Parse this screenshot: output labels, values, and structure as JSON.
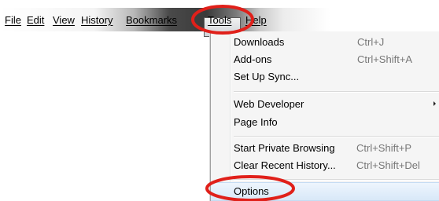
{
  "menubar": {
    "items": [
      "File",
      "Edit",
      "View",
      "History",
      "Bookmarks",
      "Tools",
      "Help"
    ]
  },
  "tools_menu": {
    "items": [
      {
        "label": "Downloads",
        "shortcut": "Ctrl+J"
      },
      {
        "label": "Add-ons",
        "shortcut": "Ctrl+Shift+A"
      },
      {
        "label": "Set Up Sync...",
        "shortcut": ""
      },
      {
        "label": "Web Developer",
        "shortcut": "",
        "submenu": true
      },
      {
        "label": "Page Info",
        "shortcut": ""
      },
      {
        "label": "Start Private Browsing",
        "shortcut": "Ctrl+Shift+P"
      },
      {
        "label": "Clear Recent History...",
        "shortcut": "Ctrl+Shift+Del"
      },
      {
        "label": "Options",
        "shortcut": ""
      }
    ]
  },
  "annotation_color": "#e0201a"
}
